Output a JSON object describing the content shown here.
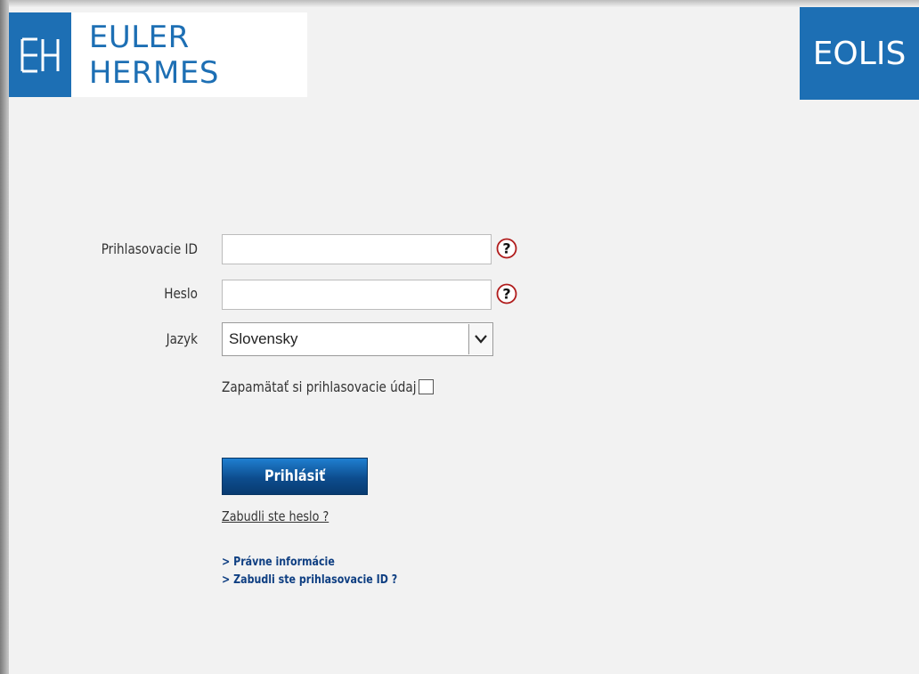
{
  "brand": {
    "name": "EULER HERMES",
    "product": "EOLIS",
    "logo_icon": "eh-logo-icon",
    "color": "#1d6fb4"
  },
  "form": {
    "login_id_label": "Prihlasovacie ID",
    "login_id_value": "",
    "password_label": "Heslo",
    "password_value": "",
    "language_label": "Jazyk",
    "language_selected": "Slovensky",
    "remember_label": "Zapamätať si prihlasovacie údaj",
    "remember_checked": false,
    "help_icon": "question-mark-icon"
  },
  "actions": {
    "login_label": "Prihlásiť",
    "forgot_password": "Zabudli ste heslo ?",
    "legal_info": "> Právne informácie",
    "forgot_login_id": "> Zabudli ste prihlasovacie ID ?"
  }
}
